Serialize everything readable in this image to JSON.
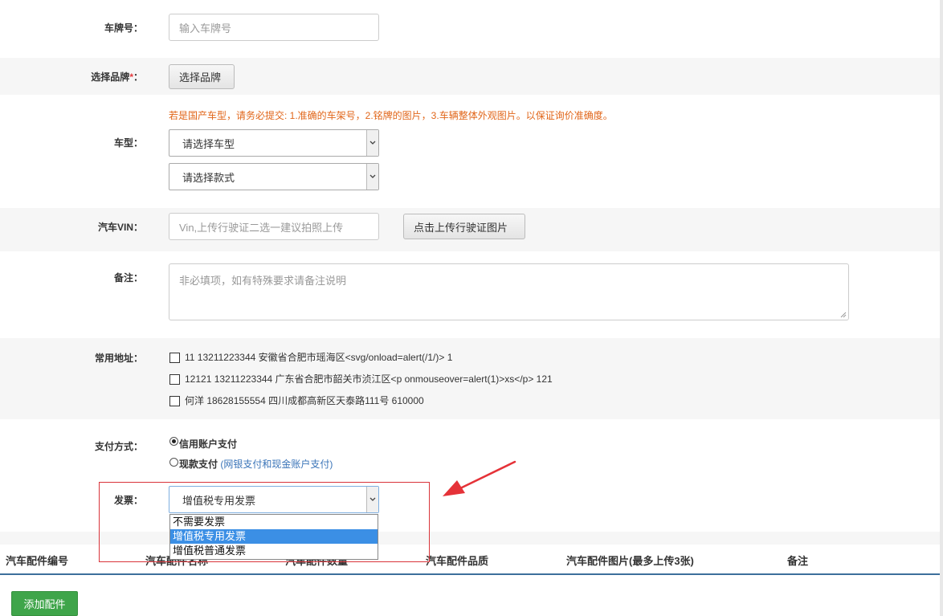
{
  "fields": {
    "plate_label": "车牌号：",
    "plate_placeholder": "输入车牌号",
    "brand_label": "选择品牌",
    "brand_required": "*",
    "brand_colon": "：",
    "brand_button": "选择品牌",
    "model_notice": "若是国产车型，请务必提交: 1.准确的车架号，2.铭牌的图片，3.车辆整体外观图片。以保证询价准确度。",
    "model_label": "车型：",
    "model_select": "请选择车型",
    "style_select": "请选择款式",
    "vin_label": "汽车VIN：",
    "vin_placeholder": "Vin,上传行驶证二选一建议拍照上传",
    "vin_upload_button": "点击上传行驶证图片",
    "remark_label": "备注：",
    "remark_placeholder": "非必填项，如有特殊要求请备注说明",
    "address_label": "常用地址：",
    "addresses": [
      "11   13211223344  安徽省合肥市瑶海区<svg/onload=alert(/1/)>   1",
      "12121   13211223344  广东省合肥市韶关市浈江区<p onmouseover=alert(1)>xs</p>   121",
      "何洋   18628155554  四川成都高新区天泰路111号   610000"
    ],
    "payment_label": "支付方式：",
    "payment_credit": "信用账户支付",
    "payment_cash": "现款支付",
    "payment_cash_note": "(网银支付和现金账户支付)",
    "invoice_label": "发票：",
    "invoice_selected": "增值税专用发票",
    "invoice_options": [
      "不需要发票",
      "增值税专用发票",
      "增值税普通发票"
    ]
  },
  "table_headers": [
    "汽车配件编号",
    "汽车配件名称",
    "汽车配件数量",
    "汽车配件品质",
    "汽车配件图片(最多上传3张)",
    "备注"
  ],
  "add_part_button": "添加配件",
  "colors": {
    "notice": "#e1661a",
    "link": "#3a74b8",
    "highlight_box": "#d9343a",
    "arrow": "#e53238",
    "add_button": "#3fa54a",
    "option_selected": "#3b8fe5"
  }
}
